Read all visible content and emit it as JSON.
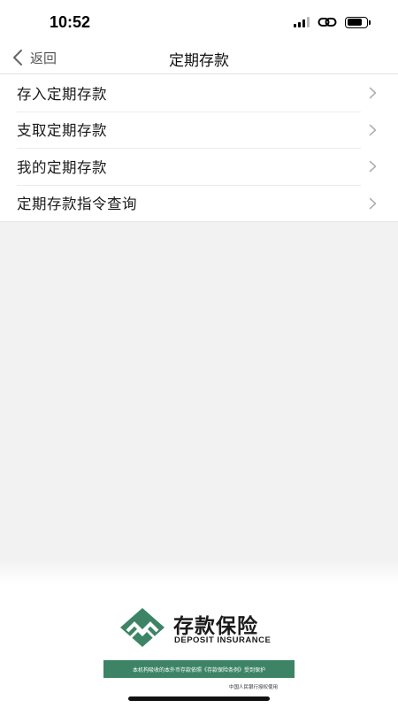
{
  "status_bar": {
    "time": "10:52",
    "icons": [
      "signal-icon",
      "link-icon",
      "battery-icon"
    ]
  },
  "nav": {
    "back_label": "返回",
    "title": "定期存款"
  },
  "menu": {
    "items": [
      {
        "label": "存入定期存款",
        "icon": "chevron-right-icon"
      },
      {
        "label": "支取定期存款",
        "icon": "chevron-right-icon"
      },
      {
        "label": "我的定期存款",
        "icon": "chevron-right-icon"
      },
      {
        "label": "定期存款指令查询",
        "icon": "chevron-right-icon"
      }
    ]
  },
  "footer": {
    "brand_cn": "存款保险",
    "brand_en": "DEPOSIT INSURANCE",
    "notice": "本机构吸收的本外币存款依照《存款保险条例》受到保护",
    "authorized": "中国人民银行授权使用",
    "brand_color": "#3d8466"
  }
}
